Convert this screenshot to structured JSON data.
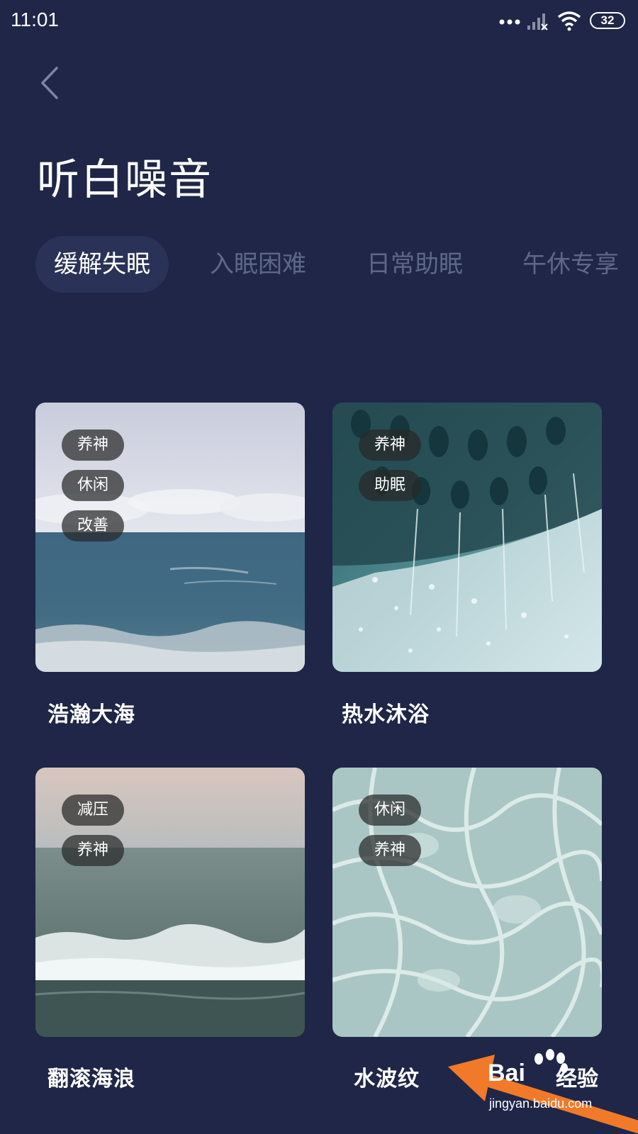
{
  "status_bar": {
    "time": "11:01",
    "battery": "32",
    "icons": [
      "more-dots-icon",
      "signal-icon",
      "wifi-icon",
      "battery-icon"
    ]
  },
  "header": {
    "back_icon": "chevron-left-icon",
    "title": "听白噪音"
  },
  "tabs": [
    {
      "label": "缓解失眠",
      "active": true
    },
    {
      "label": "入眠困难",
      "active": false
    },
    {
      "label": "日常助眠",
      "active": false
    },
    {
      "label": "午休专享",
      "active": false
    }
  ],
  "cards": [
    {
      "name": "浩瀚大海",
      "tags": [
        "养神",
        "休闲",
        "改善"
      ]
    },
    {
      "name": "热水沐浴",
      "tags": [
        "养神",
        "助眠"
      ]
    },
    {
      "name": "翻滚海浪",
      "tags": [
        "减压",
        "养神"
      ]
    },
    {
      "name": "水波纹",
      "tags": [
        "休闲",
        "养神"
      ]
    }
  ],
  "watermark": {
    "brand": "Bai",
    "brand_cn": "经验",
    "url": "jingyan.baidu.com"
  },
  "colors": {
    "background": "#1f2647",
    "tab_active_bg": "#2a3257",
    "tab_inactive_text": "#5f6788",
    "arrow": "#f07a2a"
  }
}
